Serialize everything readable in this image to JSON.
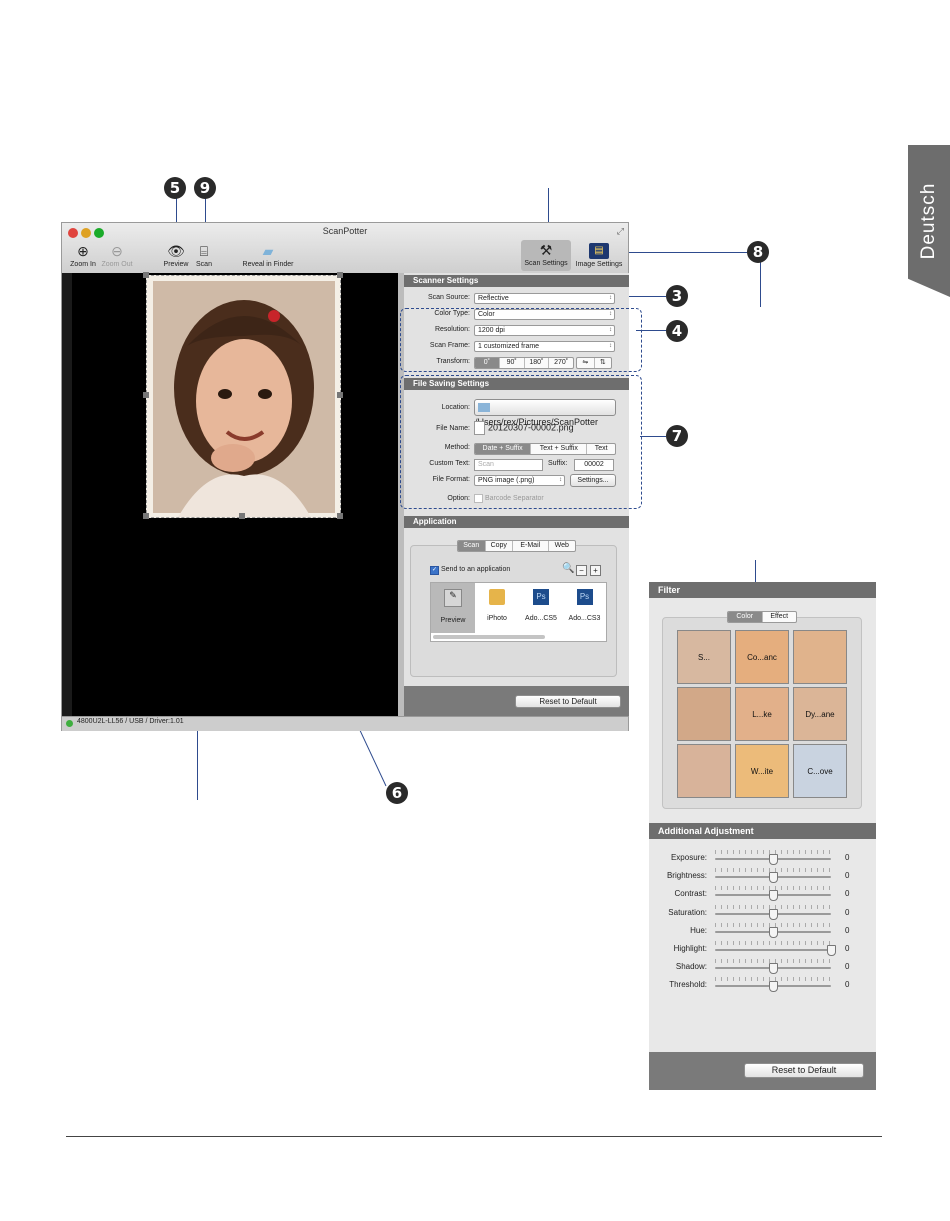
{
  "side_tab": "Deutsch",
  "callouts": [
    "5",
    "9",
    "3",
    "4",
    "7",
    "8",
    "6"
  ],
  "window": {
    "title": "ScanPotter",
    "toolbar": {
      "zoom_in": "Zoom In",
      "zoom_out": "Zoom Out",
      "preview": "Preview",
      "scan": "Scan",
      "reveal": "Reveal in Finder",
      "scan_settings": "Scan Settings",
      "image_settings": "Image Settings"
    },
    "status": "4800U2L-LL56 / USB / Driver:1.01"
  },
  "scanner_settings": {
    "header": "Scanner Settings",
    "scan_source_label": "Scan Source:",
    "scan_source": "Reflective",
    "color_type_label": "Color Type:",
    "color_type": "Color",
    "resolution_label": "Resolution:",
    "resolution": "1200 dpi",
    "scan_frame_label": "Scan Frame:",
    "scan_frame": "1 customized frame",
    "transform_label": "Transform:",
    "transform": [
      "0˚",
      "90˚",
      "180˚",
      "270˚"
    ]
  },
  "file_saving": {
    "header": "File Saving Settings",
    "location_label": "Location:",
    "location": "/Users/rex/Pictures/ScanPotter",
    "file_name_label": "File Name:",
    "file_name": "20120307-00002.png",
    "method_label": "Method:",
    "methods": [
      "Date + Suffix",
      "Text + Suffix",
      "Text"
    ],
    "custom_text_label": "Custom Text:",
    "custom_text_placeholder": "Scan",
    "suffix_label": "Suffix:",
    "suffix": "00002",
    "file_format_label": "File Format:",
    "file_format": "PNG image (.png)",
    "settings_button": "Settings...",
    "option_label": "Option:",
    "barcode": "Barcode Separator"
  },
  "application": {
    "header": "Application",
    "tabs": [
      "Scan",
      "Copy",
      "E-Mail",
      "Web"
    ],
    "send_to": "Send to an application",
    "apps": [
      "Preview",
      "iPhoto",
      "Ado...CS5",
      "Ado...CS3"
    ],
    "reset": "Reset to Default"
  },
  "filter": {
    "header": "Filter",
    "tabs": [
      "Color",
      "Effect"
    ],
    "thumbs": [
      "S...",
      "Co...anc",
      "",
      "",
      "L...ke",
      "Dy...ane",
      "",
      "W...ite",
      "C...ove"
    ],
    "adjust_header": "Additional Adjustment",
    "sliders": [
      {
        "label": "Exposure:",
        "value": "0",
        "pos": 0.5
      },
      {
        "label": "Brightness:",
        "value": "0",
        "pos": 0.5
      },
      {
        "label": "Contrast:",
        "value": "0",
        "pos": 0.5
      },
      {
        "label": "Saturation:",
        "value": "0",
        "pos": 0.5
      },
      {
        "label": "Hue:",
        "value": "0",
        "pos": 0.5
      },
      {
        "label": "Highlight:",
        "value": "0",
        "pos": 1.0
      },
      {
        "label": "Shadow:",
        "value": "0",
        "pos": 0.5
      },
      {
        "label": "Threshold:",
        "value": "0",
        "pos": 0.5
      }
    ],
    "reset": "Reset to Default"
  }
}
